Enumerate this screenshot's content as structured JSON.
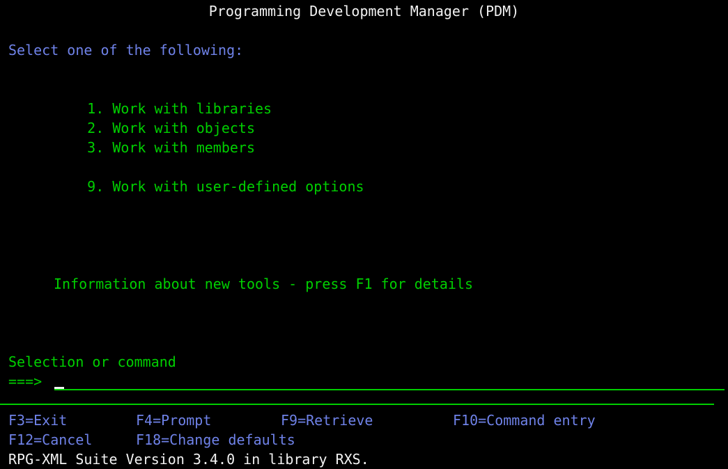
{
  "terminal": {
    "title": "Programming Development Manager (PDM)",
    "prompt_heading": "Select one of the following:",
    "menu": [
      {
        "number": "1.",
        "label": "Work with libraries"
      },
      {
        "number": "2.",
        "label": "Work with objects"
      },
      {
        "number": "3.",
        "label": "Work with members"
      },
      {
        "number": "9.",
        "label": "Work with user-defined options"
      }
    ],
    "info_line": "Information about new tools - press F1 for details",
    "selection": {
      "label": "Selection or command",
      "arrow": "===>",
      "value": "",
      "placeholder": ""
    },
    "function_keys": [
      {
        "label": "F3=Exit"
      },
      {
        "label": "F4=Prompt"
      },
      {
        "label": "F9=Retrieve"
      },
      {
        "label": "F10=Command entry"
      },
      {
        "label": "F12=Cancel"
      },
      {
        "label": "F18=Change defaults"
      }
    ],
    "status_line": "RPG-XML Suite Version 3.4.0 in library RXS.",
    "colors": {
      "background": "#000000",
      "title": "#f2f2f2",
      "green": "#00cf00",
      "blue": "#6f82e8",
      "white": "#f2f2f2"
    }
  }
}
